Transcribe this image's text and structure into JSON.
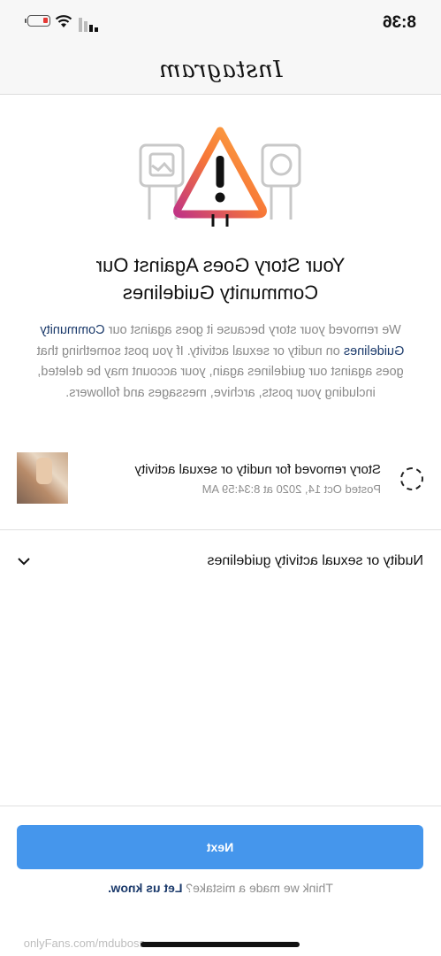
{
  "status_bar": {
    "time": "8:36"
  },
  "header": {
    "app_name": "Instagram"
  },
  "notice": {
    "title_line1": "Your Story Goes Against Our",
    "title_line2": "Community Guidelines",
    "desc_part1": "We removed your story because it goes against our",
    "desc_link": "Community Guidelines",
    "desc_part2": "on nudity or sexual activity. If you post something that goes against our guidelines again, your account may be deleted, including your posts, archive, messages and followers."
  },
  "story": {
    "title": "Story removed for nudity or sexual activity",
    "posted": "Posted Oct 14, 2020 at 8:34:59 AM"
  },
  "accordion": {
    "label": "Nudity or sexual activity guidelines"
  },
  "footer": {
    "next_label": "Next",
    "mistake_prefix": "Think we made a mistake?",
    "mistake_link": "Let us know."
  },
  "watermark": "onlyFans.com/mduboss",
  "colors": {
    "button": "#4596ec",
    "link": "#1b3a6b",
    "warning_gradient": [
      "#e1306c",
      "#f77737",
      "#fcaf45"
    ]
  }
}
